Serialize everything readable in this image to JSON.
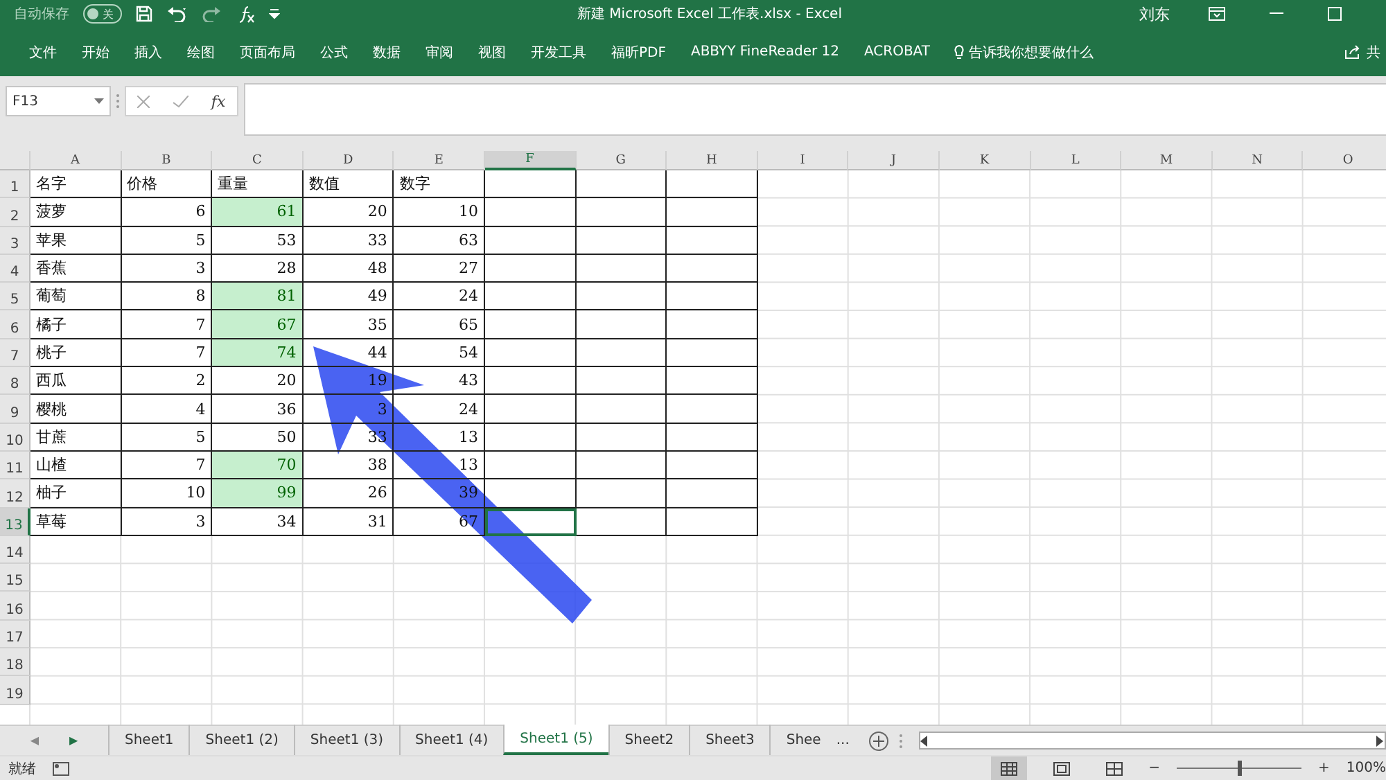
{
  "title_bar": {
    "autosave_label": "自动保存",
    "autosave_state": "关",
    "autosave_on": false,
    "title": "新建 Microsoft Excel 工作表.xlsx  -  Excel",
    "user": "刘东"
  },
  "ribbon_tabs": [
    {
      "label": "文件"
    },
    {
      "label": "开始"
    },
    {
      "label": "插入"
    },
    {
      "label": "绘图"
    },
    {
      "label": "页面布局"
    },
    {
      "label": "公式"
    },
    {
      "label": "数据"
    },
    {
      "label": "审阅"
    },
    {
      "label": "视图"
    },
    {
      "label": "开发工具"
    },
    {
      "label": "福昕PDF"
    },
    {
      "label": "ABBYY FineReader 12"
    },
    {
      "label": "ACROBAT"
    }
  ],
  "tell_me": "告诉我你想要做什么",
  "share": "共",
  "formula_bar": {
    "name_box": "F13",
    "fx": "fx"
  },
  "columns": [
    {
      "label": "A",
      "selected": false
    },
    {
      "label": "B",
      "selected": false
    },
    {
      "label": "C",
      "selected": false
    },
    {
      "label": "D",
      "selected": false
    },
    {
      "label": "E",
      "selected": false
    },
    {
      "label": "F",
      "selected": true
    },
    {
      "label": "G",
      "selected": false
    },
    {
      "label": "H",
      "selected": false
    },
    {
      "label": "I",
      "selected": false
    },
    {
      "label": "J",
      "selected": false
    },
    {
      "label": "K",
      "selected": false
    },
    {
      "label": "L",
      "selected": false
    },
    {
      "label": "M",
      "selected": false
    },
    {
      "label": "N",
      "selected": false
    },
    {
      "label": "O",
      "selected": false
    }
  ],
  "rows": [
    {
      "number": "1",
      "selected": false,
      "cells": [
        {
          "kind": "text",
          "text": "名字",
          "highlighted": false
        },
        {
          "kind": "text",
          "text": "价格",
          "highlighted": false
        },
        {
          "kind": "text",
          "text": "重量",
          "highlighted": false
        },
        {
          "kind": "text",
          "text": "数值",
          "highlighted": false
        },
        {
          "kind": "text",
          "text": "数字",
          "highlighted": false
        },
        {
          "kind": "empty",
          "highlighted": false
        },
        {
          "kind": "empty",
          "highlighted": false
        },
        {
          "kind": "empty",
          "highlighted": false
        }
      ]
    },
    {
      "number": "2",
      "selected": false,
      "cells": [
        {
          "kind": "text",
          "text": "菠萝",
          "highlighted": false
        },
        {
          "kind": "number",
          "text": "6",
          "highlighted": false
        },
        {
          "kind": "number",
          "text": "61",
          "highlighted": true
        },
        {
          "kind": "number",
          "text": "20",
          "highlighted": false
        },
        {
          "kind": "number",
          "text": "10",
          "highlighted": false
        },
        {
          "kind": "empty",
          "highlighted": false
        },
        {
          "kind": "empty",
          "highlighted": false
        },
        {
          "kind": "empty",
          "highlighted": false
        }
      ]
    },
    {
      "number": "3",
      "selected": false,
      "cells": [
        {
          "kind": "text",
          "text": "苹果",
          "highlighted": false
        },
        {
          "kind": "number",
          "text": "5",
          "highlighted": false
        },
        {
          "kind": "number",
          "text": "53",
          "highlighted": false
        },
        {
          "kind": "number",
          "text": "33",
          "highlighted": false
        },
        {
          "kind": "number",
          "text": "63",
          "highlighted": false
        },
        {
          "kind": "empty",
          "highlighted": false
        },
        {
          "kind": "empty",
          "highlighted": false
        },
        {
          "kind": "empty",
          "highlighted": false
        }
      ]
    },
    {
      "number": "4",
      "selected": false,
      "cells": [
        {
          "kind": "text",
          "text": "香蕉",
          "highlighted": false
        },
        {
          "kind": "number",
          "text": "3",
          "highlighted": false
        },
        {
          "kind": "number",
          "text": "28",
          "highlighted": false
        },
        {
          "kind": "number",
          "text": "48",
          "highlighted": false
        },
        {
          "kind": "number",
          "text": "27",
          "highlighted": false
        },
        {
          "kind": "empty",
          "highlighted": false
        },
        {
          "kind": "empty",
          "highlighted": false
        },
        {
          "kind": "empty",
          "highlighted": false
        }
      ]
    },
    {
      "number": "5",
      "selected": false,
      "cells": [
        {
          "kind": "text",
          "text": "葡萄",
          "highlighted": false
        },
        {
          "kind": "number",
          "text": "8",
          "highlighted": false
        },
        {
          "kind": "number",
          "text": "81",
          "highlighted": true
        },
        {
          "kind": "number",
          "text": "49",
          "highlighted": false
        },
        {
          "kind": "number",
          "text": "24",
          "highlighted": false
        },
        {
          "kind": "empty",
          "highlighted": false
        },
        {
          "kind": "empty",
          "highlighted": false
        },
        {
          "kind": "empty",
          "highlighted": false
        }
      ]
    },
    {
      "number": "6",
      "selected": false,
      "cells": [
        {
          "kind": "text",
          "text": "橘子",
          "highlighted": false
        },
        {
          "kind": "number",
          "text": "7",
          "highlighted": false
        },
        {
          "kind": "number",
          "text": "67",
          "highlighted": true
        },
        {
          "kind": "number",
          "text": "35",
          "highlighted": false
        },
        {
          "kind": "number",
          "text": "65",
          "highlighted": false
        },
        {
          "kind": "empty",
          "highlighted": false
        },
        {
          "kind": "empty",
          "highlighted": false
        },
        {
          "kind": "empty",
          "highlighted": false
        }
      ]
    },
    {
      "number": "7",
      "selected": false,
      "cells": [
        {
          "kind": "text",
          "text": "桃子",
          "highlighted": false
        },
        {
          "kind": "number",
          "text": "7",
          "highlighted": false
        },
        {
          "kind": "number",
          "text": "74",
          "highlighted": true
        },
        {
          "kind": "number",
          "text": "44",
          "highlighted": false
        },
        {
          "kind": "number",
          "text": "54",
          "highlighted": false
        },
        {
          "kind": "empty",
          "highlighted": false
        },
        {
          "kind": "empty",
          "highlighted": false
        },
        {
          "kind": "empty",
          "highlighted": false
        }
      ]
    },
    {
      "number": "8",
      "selected": false,
      "cells": [
        {
          "kind": "text",
          "text": "西瓜",
          "highlighted": false
        },
        {
          "kind": "number",
          "text": "2",
          "highlighted": false
        },
        {
          "kind": "number",
          "text": "20",
          "highlighted": false
        },
        {
          "kind": "number",
          "text": "19",
          "highlighted": false
        },
        {
          "kind": "number",
          "text": "43",
          "highlighted": false
        },
        {
          "kind": "empty",
          "highlighted": false
        },
        {
          "kind": "empty",
          "highlighted": false
        },
        {
          "kind": "empty",
          "highlighted": false
        }
      ]
    },
    {
      "number": "9",
      "selected": false,
      "cells": [
        {
          "kind": "text",
          "text": "樱桃",
          "highlighted": false
        },
        {
          "kind": "number",
          "text": "4",
          "highlighted": false
        },
        {
          "kind": "number",
          "text": "36",
          "highlighted": false
        },
        {
          "kind": "number",
          "text": "3",
          "highlighted": false
        },
        {
          "kind": "number",
          "text": "24",
          "highlighted": false
        },
        {
          "kind": "empty",
          "highlighted": false
        },
        {
          "kind": "empty",
          "highlighted": false
        },
        {
          "kind": "empty",
          "highlighted": false
        }
      ]
    },
    {
      "number": "10",
      "selected": false,
      "cells": [
        {
          "kind": "text",
          "text": "甘蔗",
          "highlighted": false
        },
        {
          "kind": "number",
          "text": "5",
          "highlighted": false
        },
        {
          "kind": "number",
          "text": "50",
          "highlighted": false
        },
        {
          "kind": "number",
          "text": "33",
          "highlighted": false
        },
        {
          "kind": "number",
          "text": "13",
          "highlighted": false
        },
        {
          "kind": "empty",
          "highlighted": false
        },
        {
          "kind": "empty",
          "highlighted": false
        },
        {
          "kind": "empty",
          "highlighted": false
        }
      ]
    },
    {
      "number": "11",
      "selected": false,
      "cells": [
        {
          "kind": "text",
          "text": "山楂",
          "highlighted": false
        },
        {
          "kind": "number",
          "text": "7",
          "highlighted": false
        },
        {
          "kind": "number",
          "text": "70",
          "highlighted": true
        },
        {
          "kind": "number",
          "text": "38",
          "highlighted": false
        },
        {
          "kind": "number",
          "text": "13",
          "highlighted": false
        },
        {
          "kind": "empty",
          "highlighted": false
        },
        {
          "kind": "empty",
          "highlighted": false
        },
        {
          "kind": "empty",
          "highlighted": false
        }
      ]
    },
    {
      "number": "12",
      "selected": false,
      "cells": [
        {
          "kind": "text",
          "text": "柚子",
          "highlighted": false
        },
        {
          "kind": "number",
          "text": "10",
          "highlighted": false
        },
        {
          "kind": "number",
          "text": "99",
          "highlighted": true
        },
        {
          "kind": "number",
          "text": "26",
          "highlighted": false
        },
        {
          "kind": "number",
          "text": "39",
          "highlighted": false
        },
        {
          "kind": "empty",
          "highlighted": false
        },
        {
          "kind": "empty",
          "highlighted": false
        },
        {
          "kind": "empty",
          "highlighted": false
        }
      ]
    },
    {
      "number": "13",
      "selected": true,
      "cells": [
        {
          "kind": "text",
          "text": "草莓",
          "highlighted": false
        },
        {
          "kind": "number",
          "text": "3",
          "highlighted": false
        },
        {
          "kind": "number",
          "text": "34",
          "highlighted": false
        },
        {
          "kind": "number",
          "text": "31",
          "highlighted": false
        },
        {
          "kind": "number",
          "text": "67",
          "highlighted": false
        },
        {
          "kind": "empty",
          "highlighted": false
        },
        {
          "kind": "empty",
          "highlighted": false
        },
        {
          "kind": "empty",
          "highlighted": false
        }
      ]
    },
    {
      "number": "14",
      "selected": false,
      "cells": []
    },
    {
      "number": "15",
      "selected": false,
      "cells": []
    },
    {
      "number": "16",
      "selected": false,
      "cells": []
    },
    {
      "number": "17",
      "selected": false,
      "cells": []
    },
    {
      "number": "18",
      "selected": false,
      "cells": []
    },
    {
      "number": "19",
      "selected": false,
      "cells": []
    }
  ],
  "sheet_nav": {
    "previous": "◀",
    "next": "▶"
  },
  "sheet_tabs": [
    {
      "label": "Sheet1",
      "selected": false
    },
    {
      "label": "Sheet1 (2)",
      "selected": false
    },
    {
      "label": "Sheet1 (3)",
      "selected": false
    },
    {
      "label": "Sheet1 (4)",
      "selected": false
    },
    {
      "label": "Sheet1 (5)",
      "selected": true
    },
    {
      "label": "Sheet2",
      "selected": false
    },
    {
      "label": "Sheet3",
      "selected": false
    },
    {
      "label": "Shee",
      "selected": false
    }
  ],
  "more_sheets": "...",
  "status_bar": {
    "status": "就绪",
    "zoom_out": "−",
    "zoom_in": "+",
    "zoom": "100%",
    "zoom_level": {
      "level": 0.5
    }
  }
}
